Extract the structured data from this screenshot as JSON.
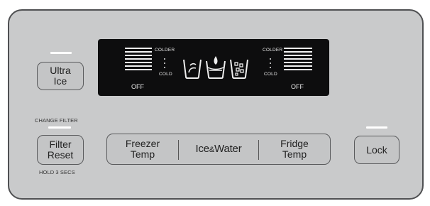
{
  "ultra_ice": {
    "line1": "Ultra",
    "line2": "Ice"
  },
  "display": {
    "left_top": "COLDER",
    "left_bottom": "COLD",
    "left_off": "OFF",
    "right_top": "COLDER",
    "right_bottom": "COLD",
    "right_off": "OFF"
  },
  "filter": {
    "change_label": "CHANGE FILTER",
    "line1": "Filter",
    "line2": "Reset",
    "hold_label": "HOLD 3 SECS"
  },
  "center_bar": {
    "freezer_line1": "Freezer",
    "freezer_line2": "Temp",
    "ice_water": "Ice",
    "amp": "&",
    "water": "Water",
    "fridge_line1": "Fridge",
    "fridge_line2": "Temp"
  },
  "lock": {
    "label": "Lock"
  },
  "icons": [
    "crushed-ice-icon",
    "water-icon",
    "cubed-ice-icon"
  ],
  "colors": {
    "panel": "#c9cacb",
    "display": "#0d0d0e",
    "border": "#4f5052"
  }
}
